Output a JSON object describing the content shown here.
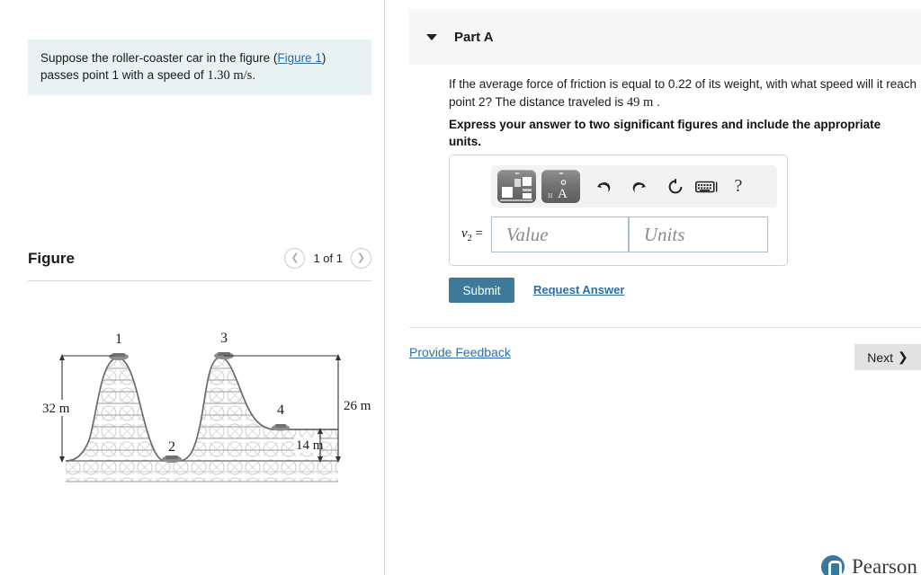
{
  "left": {
    "prompt_prefix": "Suppose the roller-coaster car in the figure (",
    "prompt_link": "Figure 1",
    "prompt_mid": ") passes point 1 with a speed of ",
    "prompt_value": "1.30 m/s",
    "prompt_suffix": ".",
    "figure_title": "Figure",
    "pager_prev_icon": "chevron-left-icon",
    "pager_label": "1 of 1",
    "pager_next_icon": "chevron-right-icon"
  },
  "figure": {
    "point_labels": [
      "1",
      "2",
      "3",
      "4"
    ],
    "dim_left": "32 m",
    "dim_right": "26 m",
    "dim_inner": "14 m"
  },
  "part": {
    "caret_icon": "caret-down-icon",
    "label": "Part A",
    "question_a": "If the average force of friction is equal to 0.22 of its weight, with what speed will it reach point 2? The distance traveled is ",
    "question_value": "49 m",
    "question_b": " .",
    "instruction": "Express your answer to two significant figures and include the appropriate units."
  },
  "answer": {
    "toolbar": {
      "templates_icon": "math-templates-icon",
      "symbols_icon": "math-symbols-icon",
      "undo_icon": "undo-icon",
      "redo_icon": "redo-icon",
      "reset_icon": "reset-icon",
      "keyboard_icon": "keyboard-icon",
      "help_icon": "help-icon",
      "help_glyph": "?"
    },
    "variable": "v",
    "variable_sub": "2",
    "equals": "=",
    "value_placeholder": "Value",
    "units_placeholder": "Units",
    "value_current": "",
    "units_current": ""
  },
  "actions": {
    "submit_label": "Submit",
    "request_answer_label": "Request Answer",
    "provide_feedback_label": "Provide Feedback",
    "next_label": "Next",
    "next_icon": "chevron-right-icon"
  },
  "footer": {
    "brand": "Pearson",
    "brand_icon": "pearson-logo-icon"
  },
  "colors": {
    "accent": "#3d7a9c",
    "link": "#2c6ea5",
    "prompt_bg": "#e9f2f2",
    "header_bg": "#f7f7f7",
    "field_border": "#a9c0d0"
  }
}
